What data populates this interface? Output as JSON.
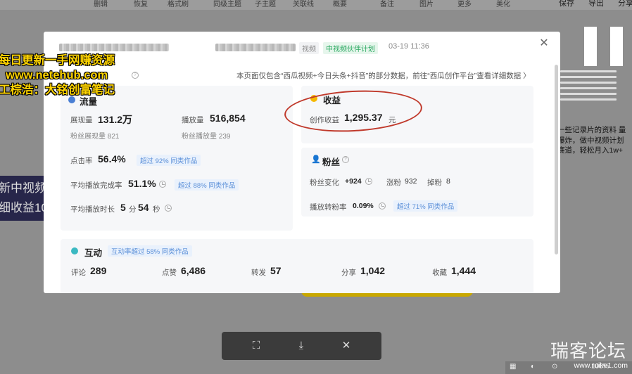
{
  "topbar": {
    "items": [
      "删辑",
      "恢复",
      "格式刷",
      "同级主题",
      "子主题",
      "关联线",
      "概要",
      "备注",
      "图片",
      "更多",
      "美化"
    ],
    "right_actions": [
      "保存",
      "导出",
      "分享"
    ]
  },
  "watermark": {
    "line1": "每日更新一手网赚资源",
    "line2": "www.netehub.com",
    "line3": "工棕浩：大铭创富笔记"
  },
  "background_left": {
    "line1": "新中视频",
    "line2": "细收益10"
  },
  "background_right": {
    "text": "一些记录片的资料 量爆炸，做中视频计划 赛道，轻松月入1w+"
  },
  "modal": {
    "header": {
      "tag_video": "视频",
      "tag_plan": "中视频伙伴计划",
      "time": "03-19 11:36"
    },
    "notice": "本页面仅包含“西瓜视频+今日头条+抖音”的部分数据，前往“西瓜创作平台”查看详细数据 〉",
    "flow": {
      "title": "流量",
      "impressions_label": "展现量",
      "impressions_value": "131.2万",
      "plays_label": "播放量",
      "plays_value": "516,854",
      "fan_impressions": "粉丝展现量 821",
      "fan_plays": "粉丝播放量 239",
      "ctr_label": "点击率",
      "ctr_value": "56.4%",
      "ctr_badge": "超过 92% 同类作品",
      "completion_label": "平均播放完成率",
      "completion_value": "51.1%",
      "completion_badge": "超过 88% 同类作品",
      "duration_label": "平均播放时长",
      "duration_min": "5",
      "duration_min_unit": "分",
      "duration_sec": "54",
      "duration_sec_unit": "秒"
    },
    "income": {
      "title": "收益",
      "label": "创作收益",
      "value": "1,295.37",
      "unit": "元"
    },
    "fans": {
      "title": "粉丝",
      "change_label": "粉丝变化",
      "change_value": "+924",
      "gain_label": "涨粉",
      "gain_value": "932",
      "loss_label": "掉粉",
      "loss_value": "8",
      "conv_label": "播放转粉率",
      "conv_value": "0.09%",
      "conv_badge": "超过 71% 同类作品"
    },
    "interaction": {
      "title": "互动",
      "badge": "互动率超过 58% 同类作品",
      "comments_label": "评论",
      "comments_value": "289",
      "likes_label": "点赞",
      "likes_value": "6,486",
      "shares_label": "转发",
      "shares_value": "57",
      "share2_label": "分享",
      "share2_value": "1,042",
      "fav_label": "收藏",
      "fav_value": "1,444"
    }
  },
  "branding": {
    "logo": "瑞客论坛",
    "url": "www.ruike1.com"
  },
  "status": {
    "zoom": "100%"
  },
  "colors": {
    "annotation_red": "#c0392b",
    "income_dot": "#f5b800",
    "flow_dot": "#4a7fd4",
    "interaction_dot": "#3bb9c2",
    "fans_icon": "#e0603a"
  }
}
